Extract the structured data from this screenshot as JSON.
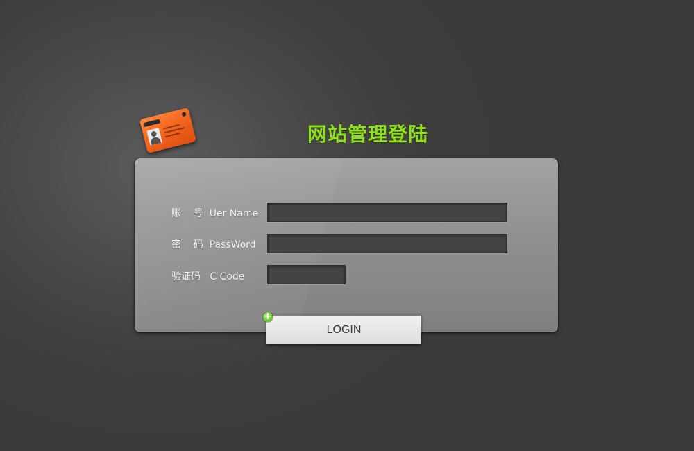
{
  "page": {
    "title": "网站管理登陆"
  },
  "form": {
    "username": {
      "label": "账    号  Uer Name",
      "value": ""
    },
    "password": {
      "label": "密    码  PassWord",
      "value": ""
    },
    "captcha": {
      "label": "验证码   C Code",
      "value": ""
    }
  },
  "actions": {
    "login_label": "LOGIN"
  },
  "icons": {
    "logo": "id-card-icon",
    "login_decoration": "plus-circle-icon"
  },
  "colors": {
    "title": "#8fe21b",
    "background": "#3b3b3b",
    "panel": "#929292",
    "card_orange": "#f1611c"
  }
}
